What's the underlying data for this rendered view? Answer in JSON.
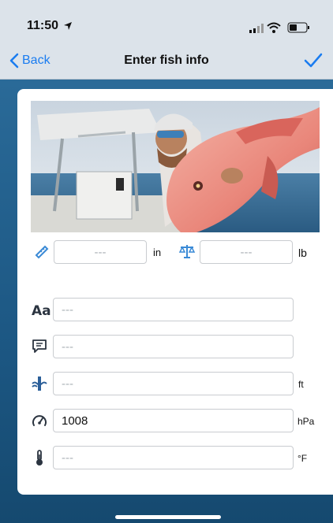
{
  "status_bar": {
    "time": "11:50"
  },
  "nav": {
    "back_label": "Back",
    "title": "Enter fish info"
  },
  "measurements": {
    "length_placeholder": "---",
    "length_unit": "in",
    "weight_placeholder": "---",
    "weight_unit": "lb"
  },
  "fields": {
    "name_placeholder": "---",
    "comment_placeholder": "---",
    "depth_placeholder": "---",
    "depth_unit": "ft",
    "pressure_value": "1008",
    "pressure_unit": "hPa",
    "temperature_placeholder": "---",
    "temperature_unit": "°F"
  },
  "icons": {
    "length": "ruler-icon",
    "weight": "scale-icon",
    "name": "text-aa-icon",
    "comment": "comment-icon",
    "depth": "depth-icon",
    "pressure": "gauge-icon",
    "temperature": "thermometer-icon"
  },
  "colors": {
    "accent": "#1a7cf0",
    "nav_bg": "#dce3ea",
    "water_bg": "#1f5b86"
  }
}
